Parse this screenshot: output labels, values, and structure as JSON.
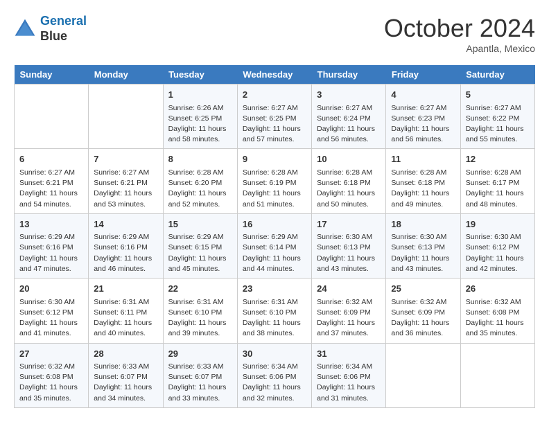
{
  "header": {
    "logo_line1": "General",
    "logo_line2": "Blue",
    "month": "October 2024",
    "location": "Apantla, Mexico"
  },
  "weekdays": [
    "Sunday",
    "Monday",
    "Tuesday",
    "Wednesday",
    "Thursday",
    "Friday",
    "Saturday"
  ],
  "weeks": [
    [
      {
        "day": "",
        "info": ""
      },
      {
        "day": "",
        "info": ""
      },
      {
        "day": "1",
        "info": "Sunrise: 6:26 AM\nSunset: 6:25 PM\nDaylight: 11 hours and 58 minutes."
      },
      {
        "day": "2",
        "info": "Sunrise: 6:27 AM\nSunset: 6:25 PM\nDaylight: 11 hours and 57 minutes."
      },
      {
        "day": "3",
        "info": "Sunrise: 6:27 AM\nSunset: 6:24 PM\nDaylight: 11 hours and 56 minutes."
      },
      {
        "day": "4",
        "info": "Sunrise: 6:27 AM\nSunset: 6:23 PM\nDaylight: 11 hours and 56 minutes."
      },
      {
        "day": "5",
        "info": "Sunrise: 6:27 AM\nSunset: 6:22 PM\nDaylight: 11 hours and 55 minutes."
      }
    ],
    [
      {
        "day": "6",
        "info": "Sunrise: 6:27 AM\nSunset: 6:21 PM\nDaylight: 11 hours and 54 minutes."
      },
      {
        "day": "7",
        "info": "Sunrise: 6:27 AM\nSunset: 6:21 PM\nDaylight: 11 hours and 53 minutes."
      },
      {
        "day": "8",
        "info": "Sunrise: 6:28 AM\nSunset: 6:20 PM\nDaylight: 11 hours and 52 minutes."
      },
      {
        "day": "9",
        "info": "Sunrise: 6:28 AM\nSunset: 6:19 PM\nDaylight: 11 hours and 51 minutes."
      },
      {
        "day": "10",
        "info": "Sunrise: 6:28 AM\nSunset: 6:18 PM\nDaylight: 11 hours and 50 minutes."
      },
      {
        "day": "11",
        "info": "Sunrise: 6:28 AM\nSunset: 6:18 PM\nDaylight: 11 hours and 49 minutes."
      },
      {
        "day": "12",
        "info": "Sunrise: 6:28 AM\nSunset: 6:17 PM\nDaylight: 11 hours and 48 minutes."
      }
    ],
    [
      {
        "day": "13",
        "info": "Sunrise: 6:29 AM\nSunset: 6:16 PM\nDaylight: 11 hours and 47 minutes."
      },
      {
        "day": "14",
        "info": "Sunrise: 6:29 AM\nSunset: 6:16 PM\nDaylight: 11 hours and 46 minutes."
      },
      {
        "day": "15",
        "info": "Sunrise: 6:29 AM\nSunset: 6:15 PM\nDaylight: 11 hours and 45 minutes."
      },
      {
        "day": "16",
        "info": "Sunrise: 6:29 AM\nSunset: 6:14 PM\nDaylight: 11 hours and 44 minutes."
      },
      {
        "day": "17",
        "info": "Sunrise: 6:30 AM\nSunset: 6:13 PM\nDaylight: 11 hours and 43 minutes."
      },
      {
        "day": "18",
        "info": "Sunrise: 6:30 AM\nSunset: 6:13 PM\nDaylight: 11 hours and 43 minutes."
      },
      {
        "day": "19",
        "info": "Sunrise: 6:30 AM\nSunset: 6:12 PM\nDaylight: 11 hours and 42 minutes."
      }
    ],
    [
      {
        "day": "20",
        "info": "Sunrise: 6:30 AM\nSunset: 6:12 PM\nDaylight: 11 hours and 41 minutes."
      },
      {
        "day": "21",
        "info": "Sunrise: 6:31 AM\nSunset: 6:11 PM\nDaylight: 11 hours and 40 minutes."
      },
      {
        "day": "22",
        "info": "Sunrise: 6:31 AM\nSunset: 6:10 PM\nDaylight: 11 hours and 39 minutes."
      },
      {
        "day": "23",
        "info": "Sunrise: 6:31 AM\nSunset: 6:10 PM\nDaylight: 11 hours and 38 minutes."
      },
      {
        "day": "24",
        "info": "Sunrise: 6:32 AM\nSunset: 6:09 PM\nDaylight: 11 hours and 37 minutes."
      },
      {
        "day": "25",
        "info": "Sunrise: 6:32 AM\nSunset: 6:09 PM\nDaylight: 11 hours and 36 minutes."
      },
      {
        "day": "26",
        "info": "Sunrise: 6:32 AM\nSunset: 6:08 PM\nDaylight: 11 hours and 35 minutes."
      }
    ],
    [
      {
        "day": "27",
        "info": "Sunrise: 6:32 AM\nSunset: 6:08 PM\nDaylight: 11 hours and 35 minutes."
      },
      {
        "day": "28",
        "info": "Sunrise: 6:33 AM\nSunset: 6:07 PM\nDaylight: 11 hours and 34 minutes."
      },
      {
        "day": "29",
        "info": "Sunrise: 6:33 AM\nSunset: 6:07 PM\nDaylight: 11 hours and 33 minutes."
      },
      {
        "day": "30",
        "info": "Sunrise: 6:34 AM\nSunset: 6:06 PM\nDaylight: 11 hours and 32 minutes."
      },
      {
        "day": "31",
        "info": "Sunrise: 6:34 AM\nSunset: 6:06 PM\nDaylight: 11 hours and 31 minutes."
      },
      {
        "day": "",
        "info": ""
      },
      {
        "day": "",
        "info": ""
      }
    ]
  ]
}
